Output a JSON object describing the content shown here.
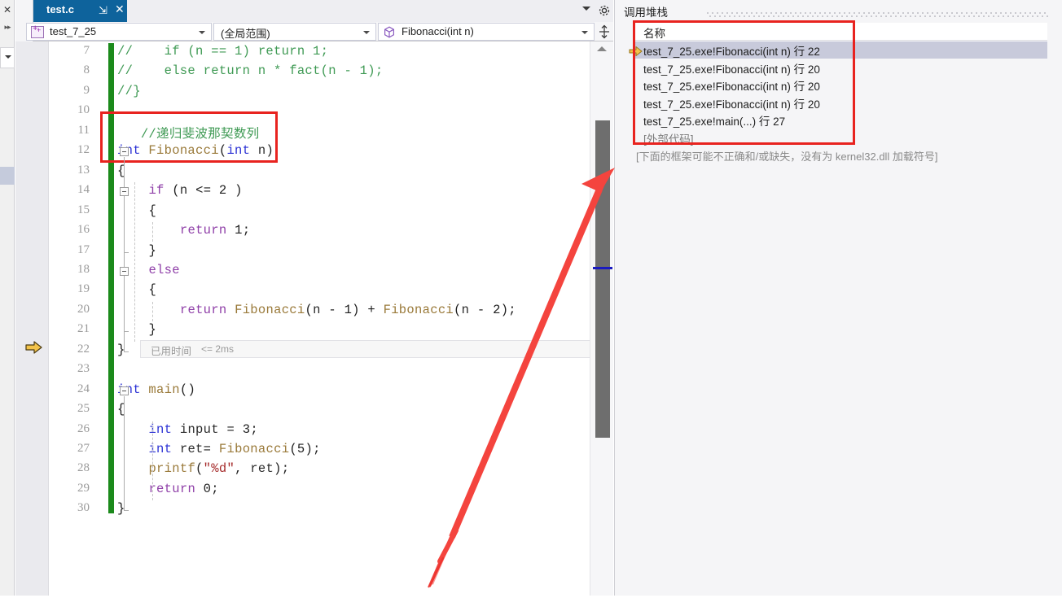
{
  "window": {
    "left_rail": {
      "close_icon": "✕",
      "expand_icon": "▸▸"
    }
  },
  "tabs": {
    "active": {
      "label": "test.c",
      "pin_glyph": "⇲",
      "close_glyph": "✕"
    },
    "overflow_caret": "chevron-down-icon",
    "settings_gear": "gear-icon"
  },
  "navbar": {
    "project": "test_7_25",
    "scope": "(全局范围)",
    "member": "Fibonacci(int n)",
    "splitter": "split-window-icon"
  },
  "editor": {
    "first_line_number": 7,
    "current_line": 22,
    "lines": [
      {
        "n": 7,
        "text": "//    if (n == 1) return 1;"
      },
      {
        "n": 8,
        "text": "//    else return n * fact(n - 1);"
      },
      {
        "n": 9,
        "text": "//}"
      },
      {
        "n": 10,
        "text": ""
      },
      {
        "n": 11,
        "text": "   //递归斐波那契数列"
      },
      {
        "n": 12,
        "text": "int Fibonacci(int n)"
      },
      {
        "n": 13,
        "text": "{"
      },
      {
        "n": 14,
        "text": "    if (n <= 2 )"
      },
      {
        "n": 15,
        "text": "    {"
      },
      {
        "n": 16,
        "text": "        return 1;"
      },
      {
        "n": 17,
        "text": "    }"
      },
      {
        "n": 18,
        "text": "    else"
      },
      {
        "n": 19,
        "text": "    {"
      },
      {
        "n": 20,
        "text": "        return Fibonacci(n - 1) + Fibonacci(n - 2);"
      },
      {
        "n": 21,
        "text": "    }"
      },
      {
        "n": 22,
        "text": "}"
      },
      {
        "n": 23,
        "text": ""
      },
      {
        "n": 24,
        "text": "int main()"
      },
      {
        "n": 25,
        "text": "{"
      },
      {
        "n": 26,
        "text": "    int input = 3;"
      },
      {
        "n": 27,
        "text": "    int ret= Fibonacci(5);"
      },
      {
        "n": 28,
        "text": "    printf(\"%d\", ret);"
      },
      {
        "n": 29,
        "text": "    return 0;"
      },
      {
        "n": 30,
        "text": "}"
      }
    ],
    "elapsed_adornment": {
      "label": "已用时间",
      "value": "<= 2ms"
    },
    "current_line_marker": "yellow-arrow-icon"
  },
  "call_stack": {
    "title": "调用堆栈",
    "column_header": "名称",
    "rows": [
      {
        "name": "test_7_25.exe!Fibonacci(int n) 行 22",
        "selected": true,
        "dim": false,
        "current": true
      },
      {
        "name": "test_7_25.exe!Fibonacci(int n) 行 20",
        "selected": false,
        "dim": false,
        "current": false
      },
      {
        "name": "test_7_25.exe!Fibonacci(int n) 行 20",
        "selected": false,
        "dim": false,
        "current": false
      },
      {
        "name": "test_7_25.exe!Fibonacci(int n) 行 20",
        "selected": false,
        "dim": false,
        "current": false
      },
      {
        "name": "test_7_25.exe!main(...) 行 27",
        "selected": false,
        "dim": false,
        "current": false
      },
      {
        "name": "[外部代码]",
        "selected": false,
        "dim": true,
        "current": false
      }
    ],
    "note": "[下面的框架可能不正确和/或缺失，没有为 kernel32.dll 加载符号]"
  },
  "annotations": {
    "accent_color": "#e8231f",
    "code_box_target": "int Fibonacci(int n)",
    "stack_box_target": "call-stack-frames",
    "arrow_from": "editor-bottom",
    "arrow_to": "scrollbar-top"
  },
  "colors": {
    "tab_active_bg": "#0e639c",
    "change_bar_green": "#1b8a1b",
    "margin_blue": "#1a1ac0",
    "annotation_red": "#e8231f",
    "selection_blue": "#c8cadb"
  }
}
